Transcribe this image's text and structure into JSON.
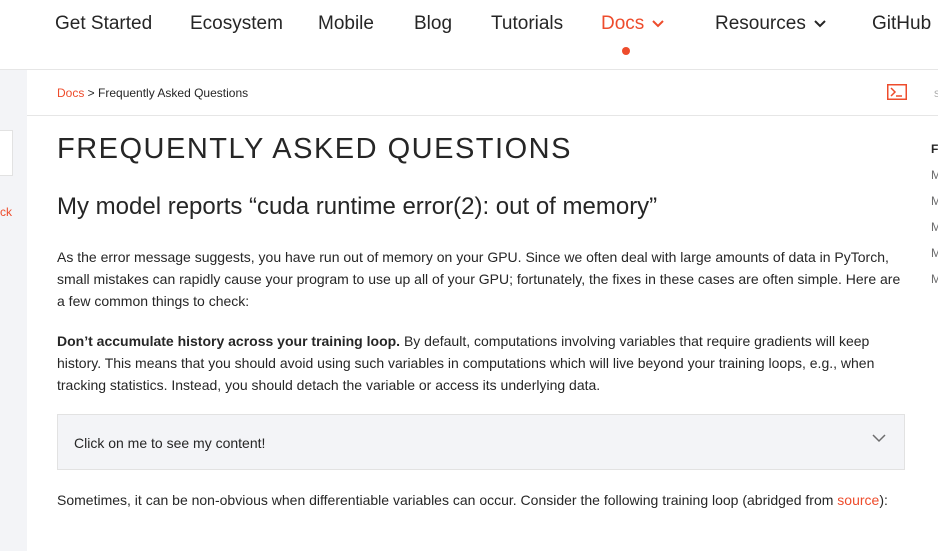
{
  "nav": {
    "items": [
      "Get Started",
      "Ecosystem",
      "Mobile",
      "Blog",
      "Tutorials"
    ],
    "docs_label": "Docs",
    "resources_label": "Resources",
    "github_label": "GitHub"
  },
  "sidebar": {
    "partial_text": "ck"
  },
  "breadcrumb": {
    "root": "Docs",
    "separator": " > ",
    "current": "Frequently Asked Questions",
    "right_partial": "s"
  },
  "main": {
    "title": "FREQUENTLY ASKED QUESTIONS",
    "heading": "My model reports “cuda runtime error(2): out of memory”",
    "para1": "As the error message suggests, you have run out of memory on your GPU. Since we often deal with large amounts of data in PyTorch, small mistakes can rapidly cause your program to use up all of your GPU; fortunately, the fixes in these cases are often simple. Here are a few common things to check:",
    "para2_bold": "Don’t accumulate history across your training loop.",
    "para2_rest": " By default, computations involving variables that require gradients will keep history. This means that you should avoid using such variables in computations which will live beyond your training loops, e.g., when tracking statistics. Instead, you should detach the variable or access its underlying data.",
    "collapsible_label": "Click on me to see my content!",
    "para3_text": "Sometimes, it can be non-obvious when differentiable variables can occur. Consider the following training loop (abridged from ",
    "para3_link": "source",
    "para3_end": "):"
  },
  "toc": {
    "head": "F",
    "items": [
      "M",
      "M",
      "M",
      "M",
      "M"
    ]
  },
  "colors": {
    "accent": "#ee4c2c",
    "text": "#262626",
    "panel": "#f3f4f7"
  }
}
